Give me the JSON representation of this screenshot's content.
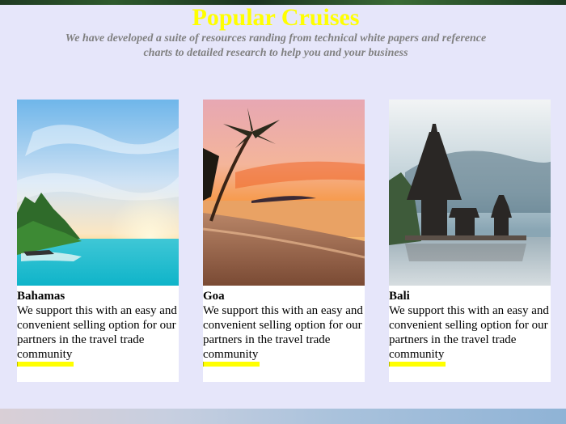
{
  "header": {
    "title": "Popular Cruises",
    "subtitle": "We have developed a suite of resources randing from technical white papers and reference charts to detailed research to help you and your business"
  },
  "colors": {
    "background": "#e6e6fa",
    "title": "#ffff00",
    "subtitle": "#808080",
    "accent": "#ffff00"
  },
  "cruises": [
    {
      "name": "Bahamas",
      "image": "tropical-beach-sunset-photo",
      "description": "We support this with an easy and convenient selling option for our partners in the travel trade community"
    },
    {
      "name": "Goa",
      "image": "palm-beach-sunset-photo",
      "description": "We support this with an easy and convenient selling option for our partners in the travel trade community"
    },
    {
      "name": "Bali",
      "image": "temple-on-lake-photo",
      "description": "We support this with an easy and convenient selling option for our partners in the travel trade community"
    }
  ]
}
